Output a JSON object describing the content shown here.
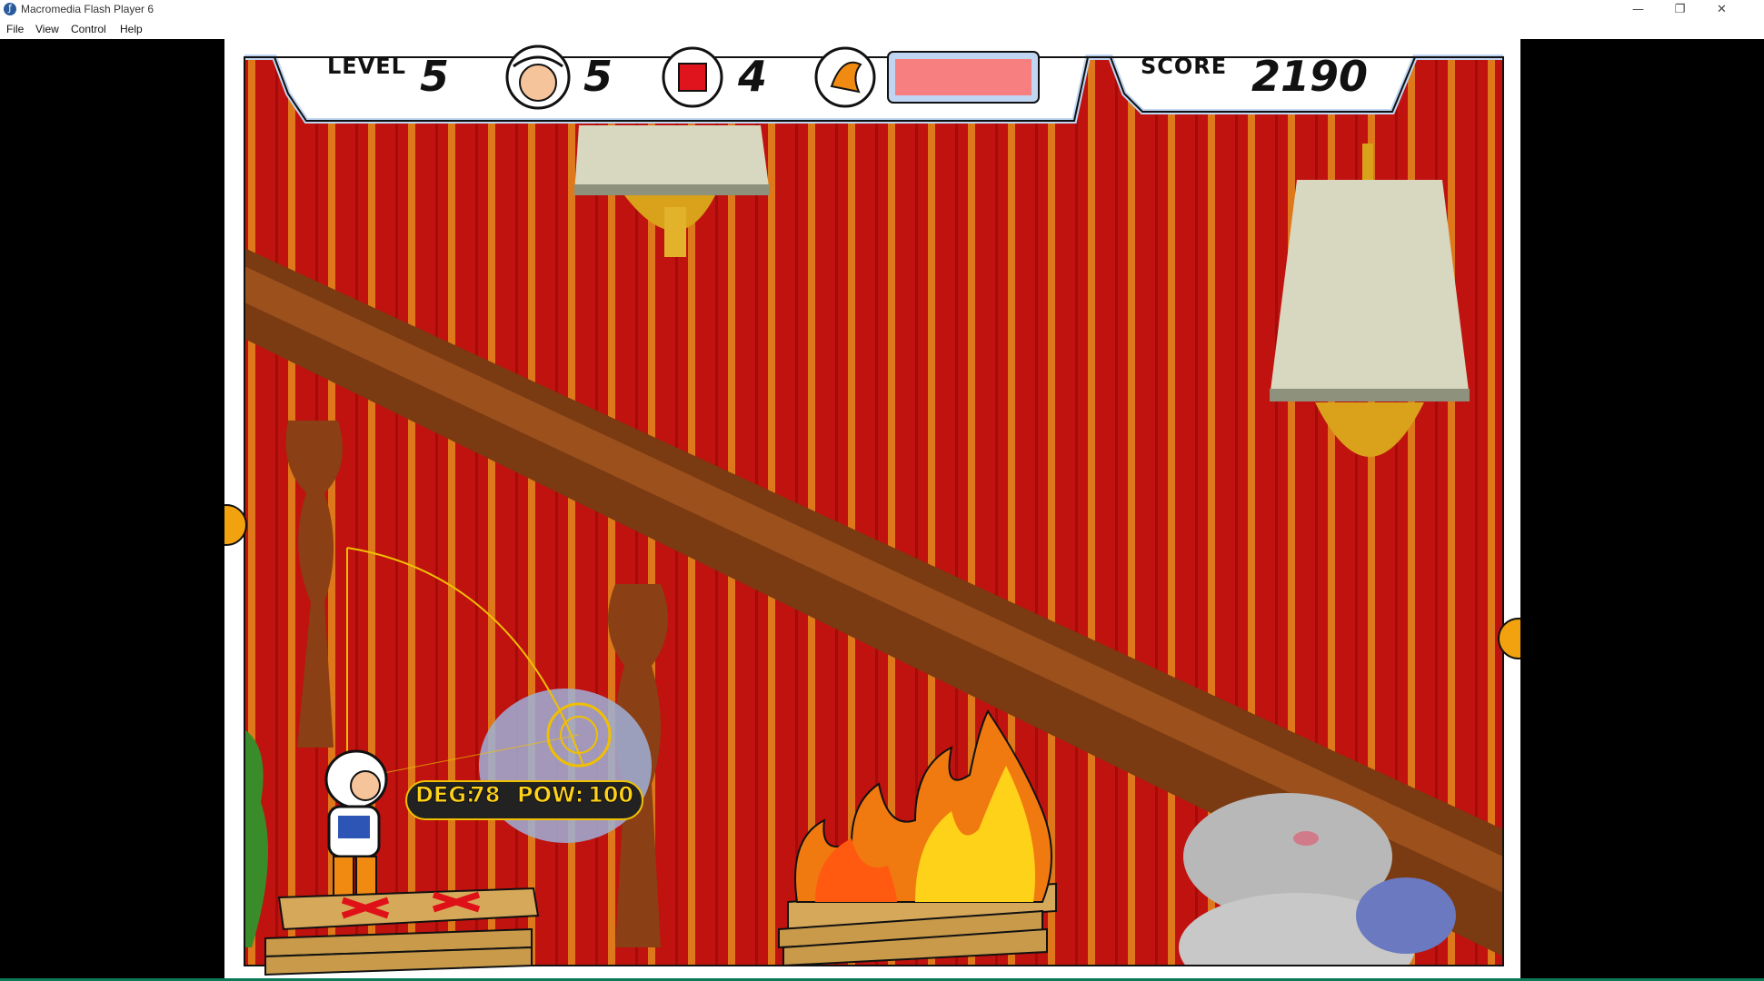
{
  "window": {
    "title": "Macromedia Flash Player 6",
    "icon": "flash-player-icon",
    "controls": [
      "minimize",
      "restore",
      "close"
    ]
  },
  "menu": {
    "items": [
      "File",
      "View",
      "Control",
      "Help"
    ]
  },
  "hud": {
    "level_label": "LEVEL",
    "level_value": "5",
    "lives_icon": "astronaut-helmet-icon",
    "lives_value": "5",
    "blocks_icon": "stop-block-icon",
    "blocks_value": "4",
    "power_icon": "flame-bird-icon",
    "score_label": "SCORE",
    "score_value": "2190"
  },
  "aim": {
    "deg_label": "DEG:",
    "deg_value": "78",
    "pow_label": "POW:",
    "pow_value": "100"
  },
  "colors": {
    "wall_red": "#c0120e",
    "stripe_orange": "#e38a1c",
    "frame_blue": "#bfd5f2",
    "power_bar": "#f77f80",
    "wood": "#c89a4a"
  }
}
